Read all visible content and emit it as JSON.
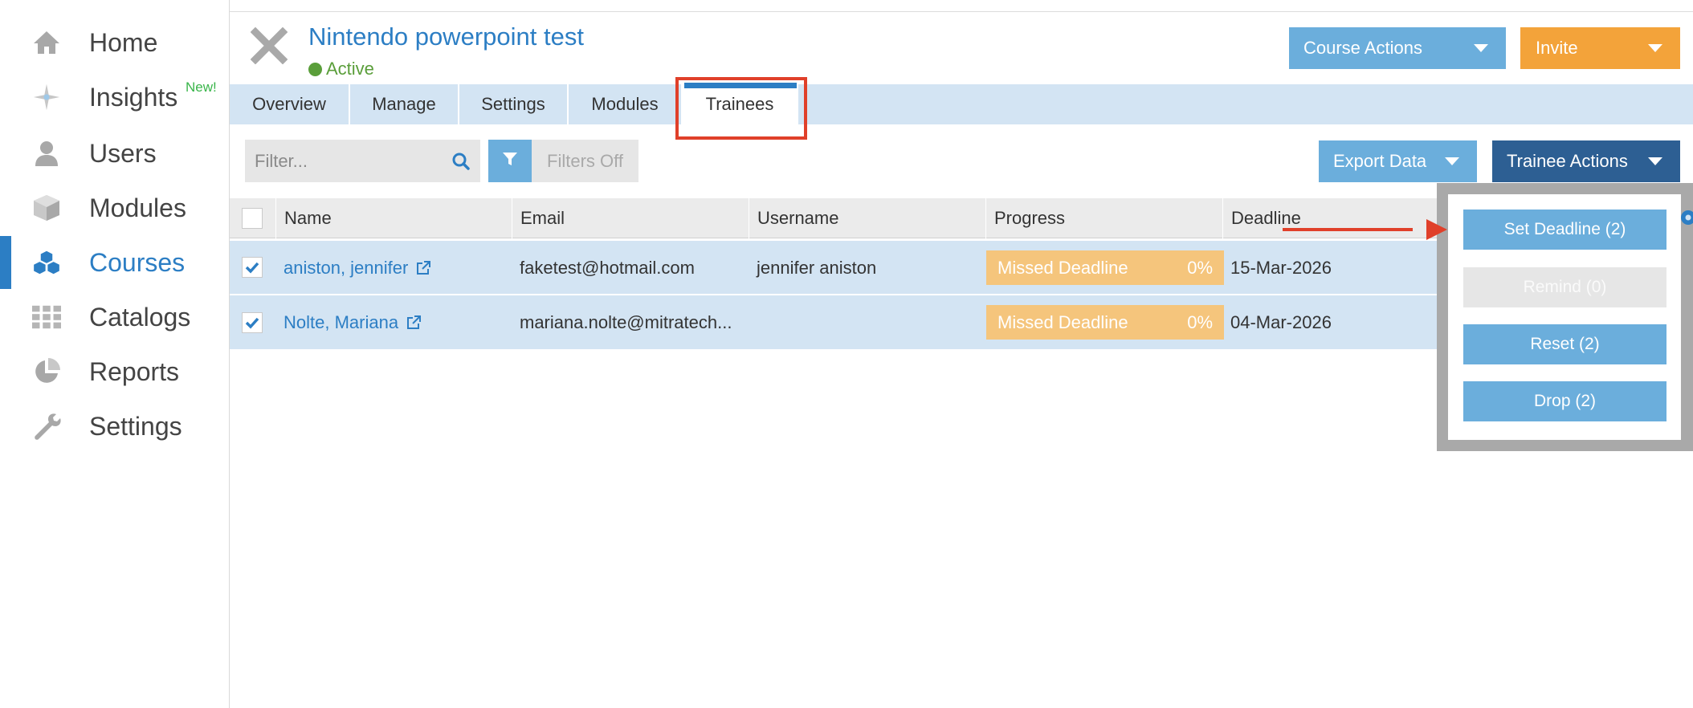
{
  "sidebar": {
    "items": [
      {
        "label": "Home",
        "icon": "home-icon"
      },
      {
        "label": "Insights",
        "icon": "insights-icon"
      },
      {
        "label": "Users",
        "icon": "user-icon"
      },
      {
        "label": "Modules",
        "icon": "module-box-icon"
      },
      {
        "label": "Courses",
        "icon": "courses-cubes-icon",
        "active": true
      },
      {
        "label": "Catalogs",
        "icon": "catalog-grid-icon"
      },
      {
        "label": "Reports",
        "icon": "pie-chart-icon"
      },
      {
        "label": "Settings",
        "icon": "wrench-icon"
      }
    ],
    "new_badge": "New!"
  },
  "header": {
    "title": "Nintendo powerpoint test",
    "status": "Active",
    "course_actions_label": "Course Actions",
    "invite_label": "Invite"
  },
  "tabs": [
    {
      "label": "Overview"
    },
    {
      "label": "Manage"
    },
    {
      "label": "Settings"
    },
    {
      "label": "Modules"
    },
    {
      "label": "Trainees",
      "active": true
    }
  ],
  "toolbar": {
    "filter_placeholder": "Filter...",
    "filters_status": "Filters Off",
    "export_label": "Export Data",
    "trainee_actions_label": "Trainee Actions"
  },
  "table": {
    "columns": [
      "Name",
      "Email",
      "Username",
      "Progress",
      "Deadline"
    ],
    "rows": [
      {
        "name": "aniston, jennifer",
        "email": "faketest@hotmail.com",
        "username": "jennifer aniston",
        "status": "Missed Deadline",
        "percent": "0%",
        "deadline": "15-Mar-2026",
        "checked": true
      },
      {
        "name": "Nolte, Mariana",
        "email": "mariana.nolte@mitratech...",
        "username": "",
        "status": "Missed Deadline",
        "percent": "0%",
        "deadline": "04-Mar-2026",
        "checked": true
      }
    ]
  },
  "trainee_menu": [
    {
      "label": "Set Deadline (2)",
      "enabled": true
    },
    {
      "label": "Remind (0)",
      "enabled": false
    },
    {
      "label": "Reset (2)",
      "enabled": true
    },
    {
      "label": "Drop (2)",
      "enabled": true
    }
  ],
  "colors": {
    "accent": "#2c7ec4",
    "button_blue": "#6baedc",
    "dark_blue": "#2d5f93",
    "orange": "#f3a33a",
    "progress_missed": "#f5c57c",
    "annotation_red": "#e0402a",
    "active_green": "#5a9e3a"
  }
}
